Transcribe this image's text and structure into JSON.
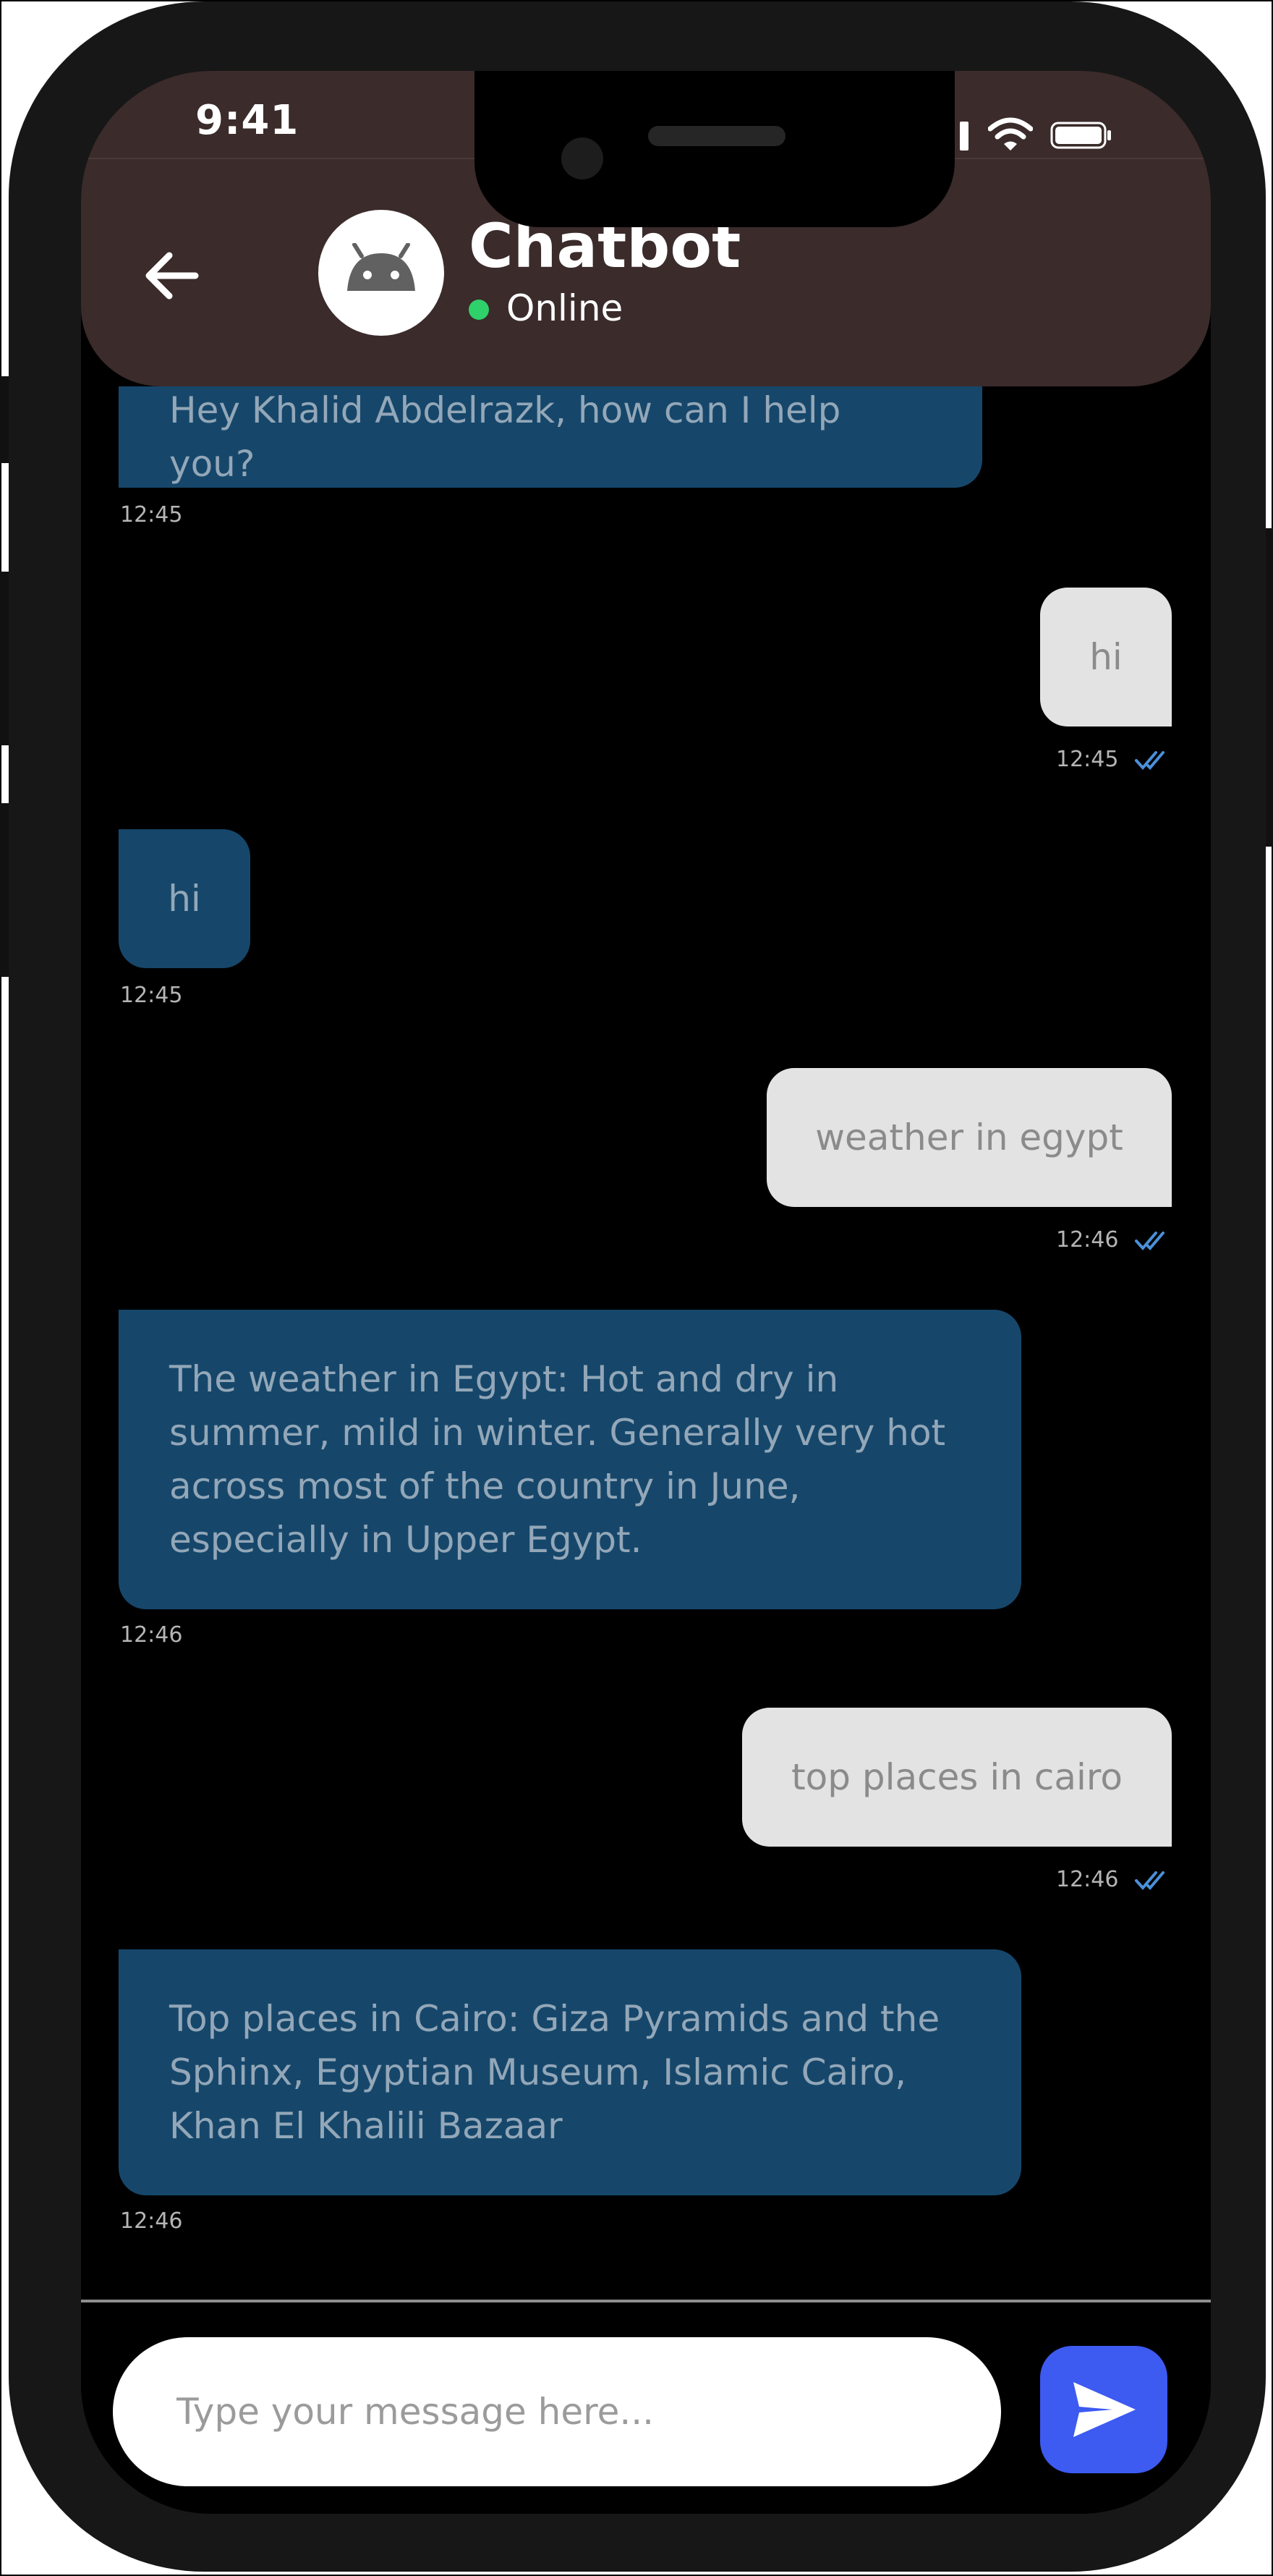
{
  "status_bar": {
    "time": "9:41"
  },
  "header": {
    "title": "Chatbot",
    "status": "Online"
  },
  "messages": [
    {
      "sender": "bot",
      "text": "Hey Khalid Abdelrazk, how can I help you?",
      "time": "12:45"
    },
    {
      "sender": "user",
      "text": "hi",
      "time": "12:45",
      "read": true
    },
    {
      "sender": "bot",
      "text": "hi",
      "time": "12:45"
    },
    {
      "sender": "user",
      "text": "weather in egypt",
      "time": "12:46",
      "read": true
    },
    {
      "sender": "bot",
      "text": "The weather in Egypt: Hot and dry in summer, mild in winter. Generally very hot across most of the country in June, especially in Upper Egypt.",
      "time": "12:46"
    },
    {
      "sender": "user",
      "text": "top places in cairo",
      "time": "12:46",
      "read": true
    },
    {
      "sender": "bot",
      "text": "Top places in Cairo: Giza Pyramids and the Sphinx, Egyptian Museum, Islamic Cairo, Khan El Khalili Bazaar",
      "time": "12:46"
    }
  ],
  "composer": {
    "placeholder": "Type your message here..."
  },
  "colors": {
    "header_bg": "#3b2b2b",
    "bot_bubble": "#16476b",
    "user_bubble": "#e3e3e3",
    "online": "#2fd16a",
    "send_button": "#3d5af1",
    "read_check": "#4a90d9"
  },
  "icons": [
    "back-arrow-icon",
    "android-icon",
    "signal-icon",
    "wifi-icon",
    "battery-icon",
    "double-check-icon",
    "send-icon"
  ]
}
